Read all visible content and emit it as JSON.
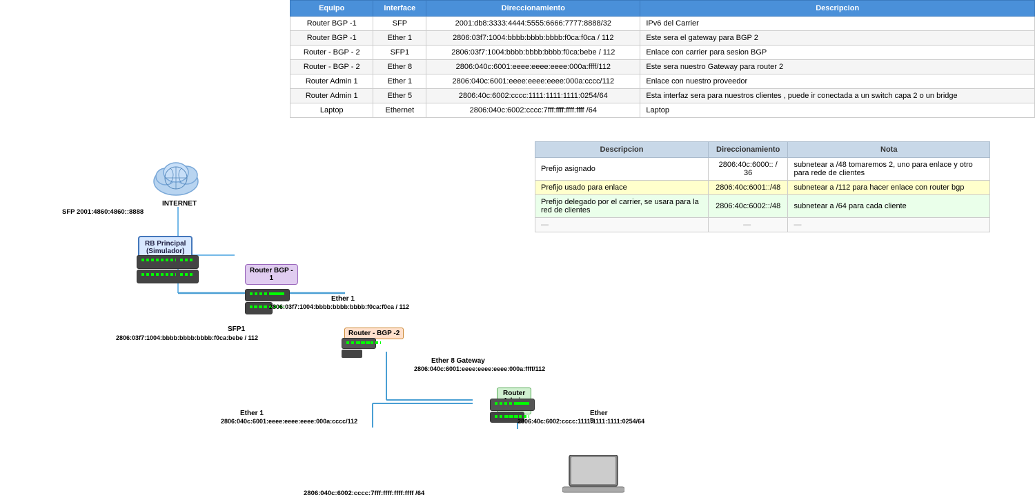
{
  "tables": {
    "main": {
      "headers": [
        "Equipo",
        "Interface",
        "Direccionamiento",
        "Descripcion"
      ],
      "rows": [
        [
          "Router BGP -1",
          "SFP",
          "2001:db8:3333:4444:5555:6666:7777:8888/32",
          "IPv6 del Carrier"
        ],
        [
          "Router BGP -1",
          "Ether 1",
          "2806:03f7:1004:bbbb:bbbb:bbbb:f0ca:f0ca / 112",
          "Este sera el gateway para BGP 2"
        ],
        [
          "Router - BGP - 2",
          "SFP1",
          "2806:03f7:1004:bbbb:bbbb:bbbb:f0ca:bebe / 112",
          "Enlace con carrier para sesion BGP"
        ],
        [
          "Router - BGP - 2",
          "Ether 8",
          "2806:040c:6001:eeee:eeee:eeee:000a:ffff/112",
          "Este sera nuestro Gateway para router 2"
        ],
        [
          "Router Admin 1",
          "Ether 1",
          "2806:040c:6001:eeee:eeee:eeee:000a:cccc/112",
          "Enlace con nuestro proveedor"
        ],
        [
          "Router Admin 1",
          "Ether 5",
          "2806:40c:6002:cccc:1111:1111:1111:0254/64",
          "Esta interfaz sera para nuestros clientes , puede ir conectada a un switch capa 2 o un bridge"
        ],
        [
          "Laptop",
          "Ethernet",
          "2806:040c:6002:cccc:7fff:ffff:ffff:ffff /64",
          "Laptop"
        ]
      ]
    },
    "bottom": {
      "headers": [
        "Descripcion",
        "Direccionamiento",
        "Nota"
      ],
      "rows": [
        {
          "cells": [
            "Prefijo asignado",
            "2806:40c:6000:: / 36",
            "subnetear a /48  tomaremos 2, uno para enlace y otro para rede de clientes"
          ],
          "class": ""
        },
        {
          "cells": [
            "Prefijo usado para enlace",
            "2806:40c:6001::/48",
            "subnetear a /112 para hacer enlace con router bgp"
          ],
          "class": "yellow-row"
        },
        {
          "cells": [
            "Prefijo delegado por el carrier, se usara para la red de clientes",
            "2806:40c:6002::/48",
            "subnetear a /64 para cada cliente"
          ],
          "class": "green-row"
        },
        {
          "cells": [
            "—",
            "—",
            "—"
          ],
          "class": "dots-row"
        }
      ]
    }
  },
  "diagram": {
    "internet": {
      "label": "INTERNET",
      "sub_label": "SFP 2001:4860:4860::8888"
    },
    "rb_principal": {
      "line1": "RB Principal",
      "line2": "(Simulador)"
    },
    "router_bgp1": {
      "label": "Router BGP -\n1"
    },
    "router_bgp2": {
      "label": "Router - BGP -2"
    },
    "router_admin1": {
      "label": "Router Admin 1"
    },
    "connections": [
      {
        "from": "internet",
        "to": "rb_principal",
        "iface": "Ether 1",
        "addr": "2806:03f7:1004:bbbb:bbbb:bbbb:f0ca:f0ca / 112"
      },
      {
        "from": "rb_principal",
        "to": "router_bgp2",
        "iface": "SFP1",
        "addr": "2806:03f7:1004:bbbb:bbbb:bbbb:f0ca:bebe / 112"
      },
      {
        "from": "router_bgp2",
        "to": "router_admin1",
        "iface": "Ether 8 Gateway",
        "addr": "2806:040c:6001:eeee:eeee:eeee:000a:ffff/112"
      },
      {
        "from": "router_admin1",
        "to": "laptop",
        "iface": "Ether 1",
        "addr": "2806:040c:6001:eeee:eeee:eeee:000a:cccc/112"
      },
      {
        "from": "router_admin1",
        "to": "laptop2",
        "iface": "Ether 5",
        "addr": "2806:40c:6002:cccc:1111:1111:1111:0254/64"
      }
    ]
  }
}
